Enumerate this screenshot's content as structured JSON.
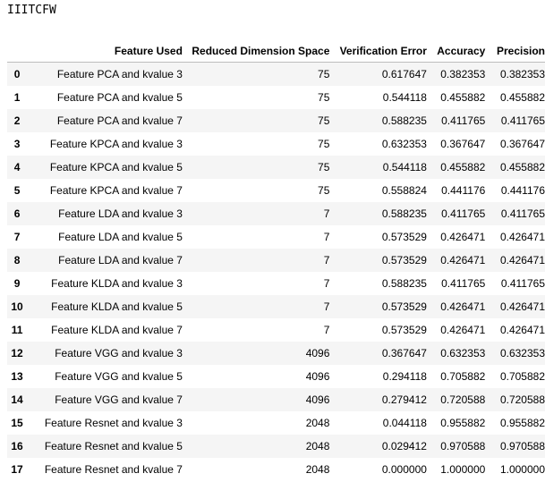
{
  "output_label": "IIITCFW",
  "table": {
    "columns": [
      "Feature Used",
      "Reduced Dimension Space",
      "Verification Error",
      "Accuracy",
      "Precision"
    ],
    "rows": [
      {
        "index": "0",
        "feature": "Feature PCA and kvalue 3",
        "dim": "75",
        "error": "0.617647",
        "accuracy": "0.382353",
        "precision": "0.382353"
      },
      {
        "index": "1",
        "feature": "Feature PCA and kvalue 5",
        "dim": "75",
        "error": "0.544118",
        "accuracy": "0.455882",
        "precision": "0.455882"
      },
      {
        "index": "2",
        "feature": "Feature PCA and kvalue 7",
        "dim": "75",
        "error": "0.588235",
        "accuracy": "0.411765",
        "precision": "0.411765"
      },
      {
        "index": "3",
        "feature": "Feature KPCA and kvalue 3",
        "dim": "75",
        "error": "0.632353",
        "accuracy": "0.367647",
        "precision": "0.367647"
      },
      {
        "index": "4",
        "feature": "Feature KPCA and kvalue 5",
        "dim": "75",
        "error": "0.544118",
        "accuracy": "0.455882",
        "precision": "0.455882"
      },
      {
        "index": "5",
        "feature": "Feature KPCA and kvalue 7",
        "dim": "75",
        "error": "0.558824",
        "accuracy": "0.441176",
        "precision": "0.441176"
      },
      {
        "index": "6",
        "feature": "Feature LDA and kvalue 3",
        "dim": "7",
        "error": "0.588235",
        "accuracy": "0.411765",
        "precision": "0.411765"
      },
      {
        "index": "7",
        "feature": "Feature LDA and kvalue 5",
        "dim": "7",
        "error": "0.573529",
        "accuracy": "0.426471",
        "precision": "0.426471"
      },
      {
        "index": "8",
        "feature": "Feature LDA and kvalue 7",
        "dim": "7",
        "error": "0.573529",
        "accuracy": "0.426471",
        "precision": "0.426471"
      },
      {
        "index": "9",
        "feature": "Feature KLDA and kvalue 3",
        "dim": "7",
        "error": "0.588235",
        "accuracy": "0.411765",
        "precision": "0.411765"
      },
      {
        "index": "10",
        "feature": "Feature KLDA and kvalue 5",
        "dim": "7",
        "error": "0.573529",
        "accuracy": "0.426471",
        "precision": "0.426471"
      },
      {
        "index": "11",
        "feature": "Feature KLDA and kvalue 7",
        "dim": "7",
        "error": "0.573529",
        "accuracy": "0.426471",
        "precision": "0.426471"
      },
      {
        "index": "12",
        "feature": "Feature VGG and kvalue 3",
        "dim": "4096",
        "error": "0.367647",
        "accuracy": "0.632353",
        "precision": "0.632353"
      },
      {
        "index": "13",
        "feature": "Feature VGG and kvalue 5",
        "dim": "4096",
        "error": "0.294118",
        "accuracy": "0.705882",
        "precision": "0.705882"
      },
      {
        "index": "14",
        "feature": "Feature VGG and kvalue 7",
        "dim": "4096",
        "error": "0.279412",
        "accuracy": "0.720588",
        "precision": "0.720588"
      },
      {
        "index": "15",
        "feature": "Feature Resnet and kvalue 3",
        "dim": "2048",
        "error": "0.044118",
        "accuracy": "0.955882",
        "precision": "0.955882"
      },
      {
        "index": "16",
        "feature": "Feature Resnet and kvalue 5",
        "dim": "2048",
        "error": "0.029412",
        "accuracy": "0.970588",
        "precision": "0.970588"
      },
      {
        "index": "17",
        "feature": "Feature Resnet and kvalue 7",
        "dim": "2048",
        "error": "0.000000",
        "accuracy": "1.000000",
        "precision": "1.000000"
      }
    ]
  }
}
